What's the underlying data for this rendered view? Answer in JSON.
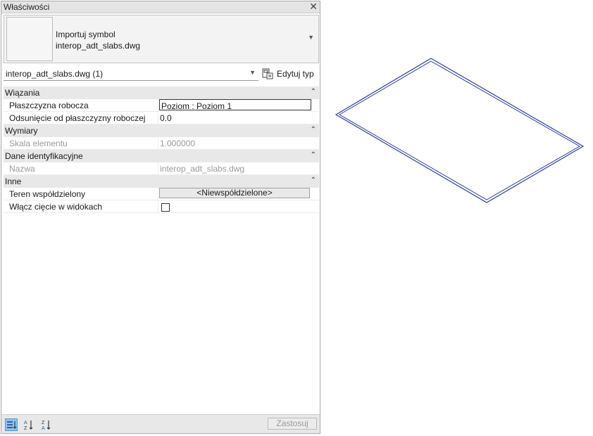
{
  "panel": {
    "title": "Właściwości",
    "close_glyph": "✕",
    "type_preview": {
      "line1": "Importuj symbol",
      "line2": "interop_adt_slabs.dwg",
      "dropdown_icon": "chevron-down-icon"
    },
    "selector": {
      "value": "interop_adt_slabs.dwg (1)",
      "dropdown_icon": "chevron-down-icon"
    },
    "edit_type": {
      "label": "Edytuj typ",
      "icon": "edit-type-icon"
    }
  },
  "categories": [
    {
      "name": "Wiązania",
      "rows": [
        {
          "label": "Płaszczyzna robocza",
          "value": "Poziom : Poziom 1",
          "kind": "input"
        },
        {
          "label": "Odsunięcie od płaszczyzny roboczej",
          "value": "0.0",
          "kind": "text"
        }
      ]
    },
    {
      "name": "Wymiary",
      "rows": [
        {
          "label": "Skala elementu",
          "value": "1.000000",
          "kind": "readonly"
        }
      ]
    },
    {
      "name": "Dane identyfikacyjne",
      "rows": [
        {
          "label": "Nazwa",
          "value": "interop_adt_slabs.dwg",
          "kind": "readonly"
        }
      ]
    },
    {
      "name": "Inne",
      "rows": [
        {
          "label": "Teren współdzielony",
          "value": "<Niewspółdzielone>",
          "kind": "button"
        },
        {
          "label": "Włącz cięcie w widokach",
          "value": "",
          "kind": "checkbox",
          "checked": false
        }
      ]
    }
  ],
  "footer": {
    "sort_buttons": [
      "categorized-sort-icon",
      "sort-ascending-icon",
      "sort-descending-icon"
    ],
    "apply_label": "Zastosuj"
  },
  "colors": {
    "accent": "#8fc3ec",
    "model_edge": "#2a3f9e"
  }
}
